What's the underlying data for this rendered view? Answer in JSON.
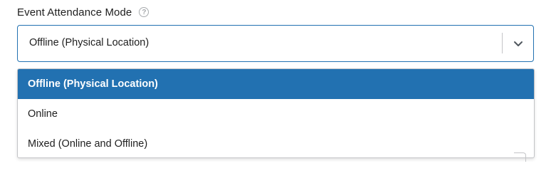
{
  "field": {
    "label": "Event Attendance Mode",
    "help_icon_glyph": "?",
    "help_icon": "question-circle-icon"
  },
  "select": {
    "value": "Offline (Physical Location)",
    "chevron_icon": "chevron-down-icon"
  },
  "dropdown": {
    "options": [
      {
        "label": "Offline (Physical Location)",
        "selected": true
      },
      {
        "label": "Online",
        "selected": false
      },
      {
        "label": "Mixed (Online and Offline)",
        "selected": false
      }
    ]
  },
  "colors": {
    "accent": "#2271b1",
    "border": "#c3c4c7",
    "text": "#1e1e1e",
    "help_icon": "#a7aaad"
  }
}
